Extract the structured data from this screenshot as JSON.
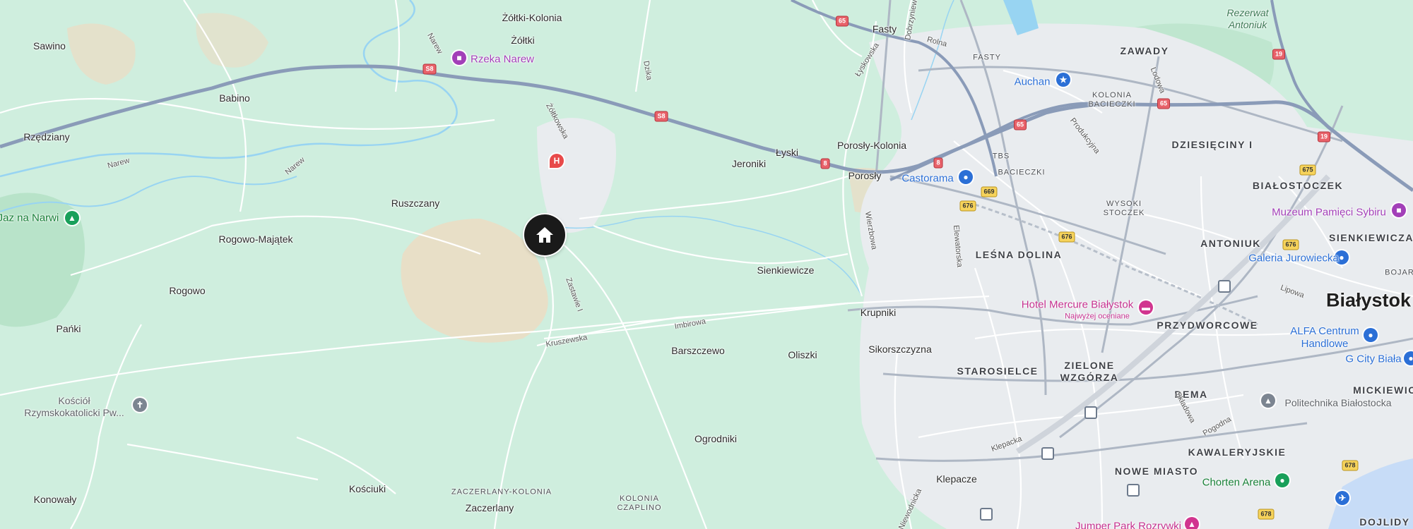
{
  "map": {
    "colors": {
      "land": "#cfeede",
      "urban": "#e9ecef",
      "sand": "#ecdcc3",
      "water": "#98d4f2",
      "highway": "#8a9bb8",
      "road": "#ffffff"
    },
    "home_marker": {
      "icon": "home-icon"
    },
    "places": {
      "sawino": "Sawino",
      "babino": "Babino",
      "rzedziany": "Rzędziany",
      "zoltki_kolonia": "Żółtki-Kolonia",
      "zoltki": "Żółtki",
      "ruszczany": "Ruszczany",
      "rogowo_majatek": "Rogowo-Majątek",
      "rogowo": "Rogowo",
      "panki": "Pańki",
      "konowaly": "Konowały",
      "koscicuki": "Kościuki",
      "zaczerlany": "Zaczerlany",
      "zaczerlany_kolonia": "ZACZERLANY-KOLONIA",
      "kolonia_czaplino": "KOLONIA\nCZAPLINO",
      "ogrodniki": "Ogrodniki",
      "barszczewo": "Barszczewo",
      "oliszki": "Oliszki",
      "sienkiewicze": "Sienkiewicze",
      "jeroniki": "Jeroniki",
      "lyski": "Łyski",
      "porosly_kolonia": "Porosły-Kolonia",
      "porosly": "Porosły",
      "krupniki": "Krupniki",
      "sikorszczyzna": "Sikorszczyzna",
      "klepacze": "Klepacze",
      "fasty": "Fasty",
      "fasty_caps": "FASTY",
      "bialystok": "Białystok"
    },
    "districts": {
      "zawady": "ZAWADY",
      "kolonia_bacieczki": "KOLONIA\nBACIECZKI",
      "dziesieciny": "DZIESIĘCINY I",
      "tbs": "TBS",
      "bacieczki": "BACIECZKI",
      "wysoki_stoczek": "WYSOKI\nSTOCZEK",
      "bialostoczek": "BIAŁOSTOCZEK",
      "antoniuk": "ANTONIUK",
      "sienkiewicza": "SIENKIEWICZA",
      "lesna_dolina": "LEŚNA DOLINA",
      "przydworcowe": "PRZYDWORCOWE",
      "starosielce": "STAROSIELCE",
      "zielone_wzgorza": "ZIELONE\nWZGÓRZA",
      "bema": "BEMA",
      "kawaleryjskie": "KAWALERYJSKIE",
      "nowe_miasto": "NOWE MIASTO",
      "mickiewic": "MICKIEWIC",
      "dojlidy": "DOJLIDY",
      "bojar": "BOJAR"
    },
    "streets": {
      "zoltkowska": "Żółtkowska",
      "dzika": "Dzika",
      "narew1": "Narew",
      "narew2": "Narew",
      "narew3": "Narew",
      "zastawie": "Zastawie I",
      "imbirowa": "Imbirowa",
      "kruszewska": "Kruszewska",
      "lyskowska": "Łyskowska",
      "dobrzyniewska": "Dobrzyniewska",
      "rolna": "Rolna",
      "lodowa": "Lodowa",
      "produkcyjna": "Produkcyjna",
      "wierzbowa": "Wierzbowa",
      "elewatorska": "Elewatorska",
      "lipowa": "Lipowa",
      "skladowa": "Składowa",
      "pogodna": "Pogodna",
      "klepacka": "Klepacka",
      "niewodnicka": "Niewodnicka"
    },
    "pois": {
      "rzeka_narew": "Rzeka Narew",
      "auchan": "Auchan",
      "castorama": "Castorama",
      "muzeum": "Muzeum Pamięci Sybiru",
      "galeria": "Galeria Jurowiecka",
      "hotel": "Hotel Mercure Białystok",
      "hotel_sub": "Najwyżej oceniane",
      "alfa": "ALFA Centrum\nHandlowe",
      "gcity": "G City Biała",
      "politechnika": "Politechnika Białostocka",
      "chorten": "Chorten Arena",
      "jumper": "Jumper Park Rozrywki",
      "koscielny": "Kościół\nRzymskokatolicki Pw...",
      "jaz": "Jaz na Narwi",
      "rezerwat": "Rezerwat\nAntoniuk"
    },
    "shields": {
      "s8": "S8",
      "r65": "65",
      "r19": "19",
      "r8": "8",
      "r669": "669",
      "r676": "676",
      "r675": "675",
      "r678": "678"
    }
  }
}
